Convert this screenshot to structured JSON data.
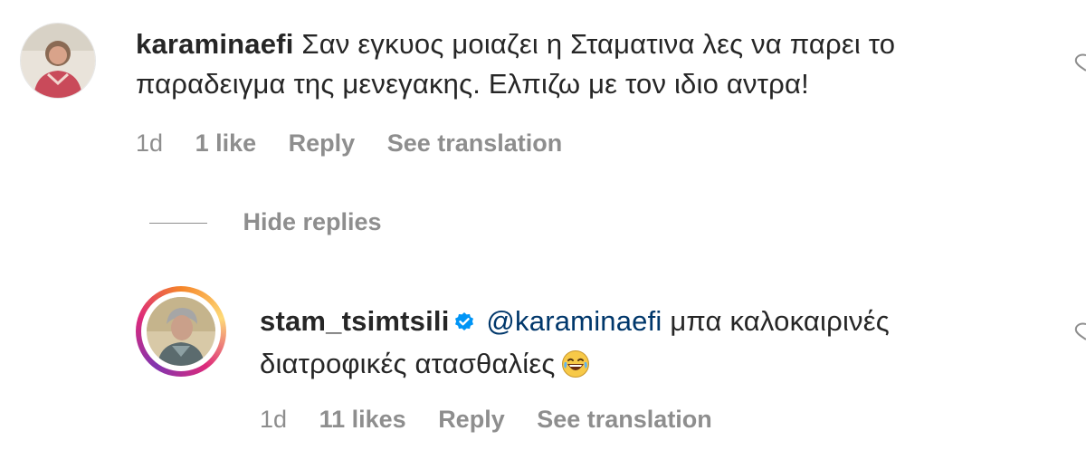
{
  "comments": [
    {
      "username": "karaminaefi",
      "text": "Σαν εγκυος μοιαζει η Σταματινα λες να παρει το παραδειγμα της μενεγακης. Ελπιζω με τον ιδιο αντρα!",
      "age": "1d",
      "likes": "1 like",
      "reply_label": "Reply",
      "translate_label": "See translation",
      "avatar_icon": "user-avatar-icon"
    },
    {
      "username": "stam_tsimtsili",
      "verified": true,
      "mention": "@karaminaefi",
      "text": "μπα καλοκαιρινές διατροφικές ατασθαλίες",
      "emoji": "😂",
      "age": "1d",
      "likes": "11 likes",
      "reply_label": "Reply",
      "translate_label": "See translation",
      "avatar_icon": "user-avatar-icon",
      "has_story_ring": true
    }
  ],
  "replies_toggle": {
    "label": "Hide replies"
  },
  "colors": {
    "text": "#262626",
    "secondary": "#8e8e8e",
    "mention": "#00376b",
    "verified": "#0095f6"
  }
}
